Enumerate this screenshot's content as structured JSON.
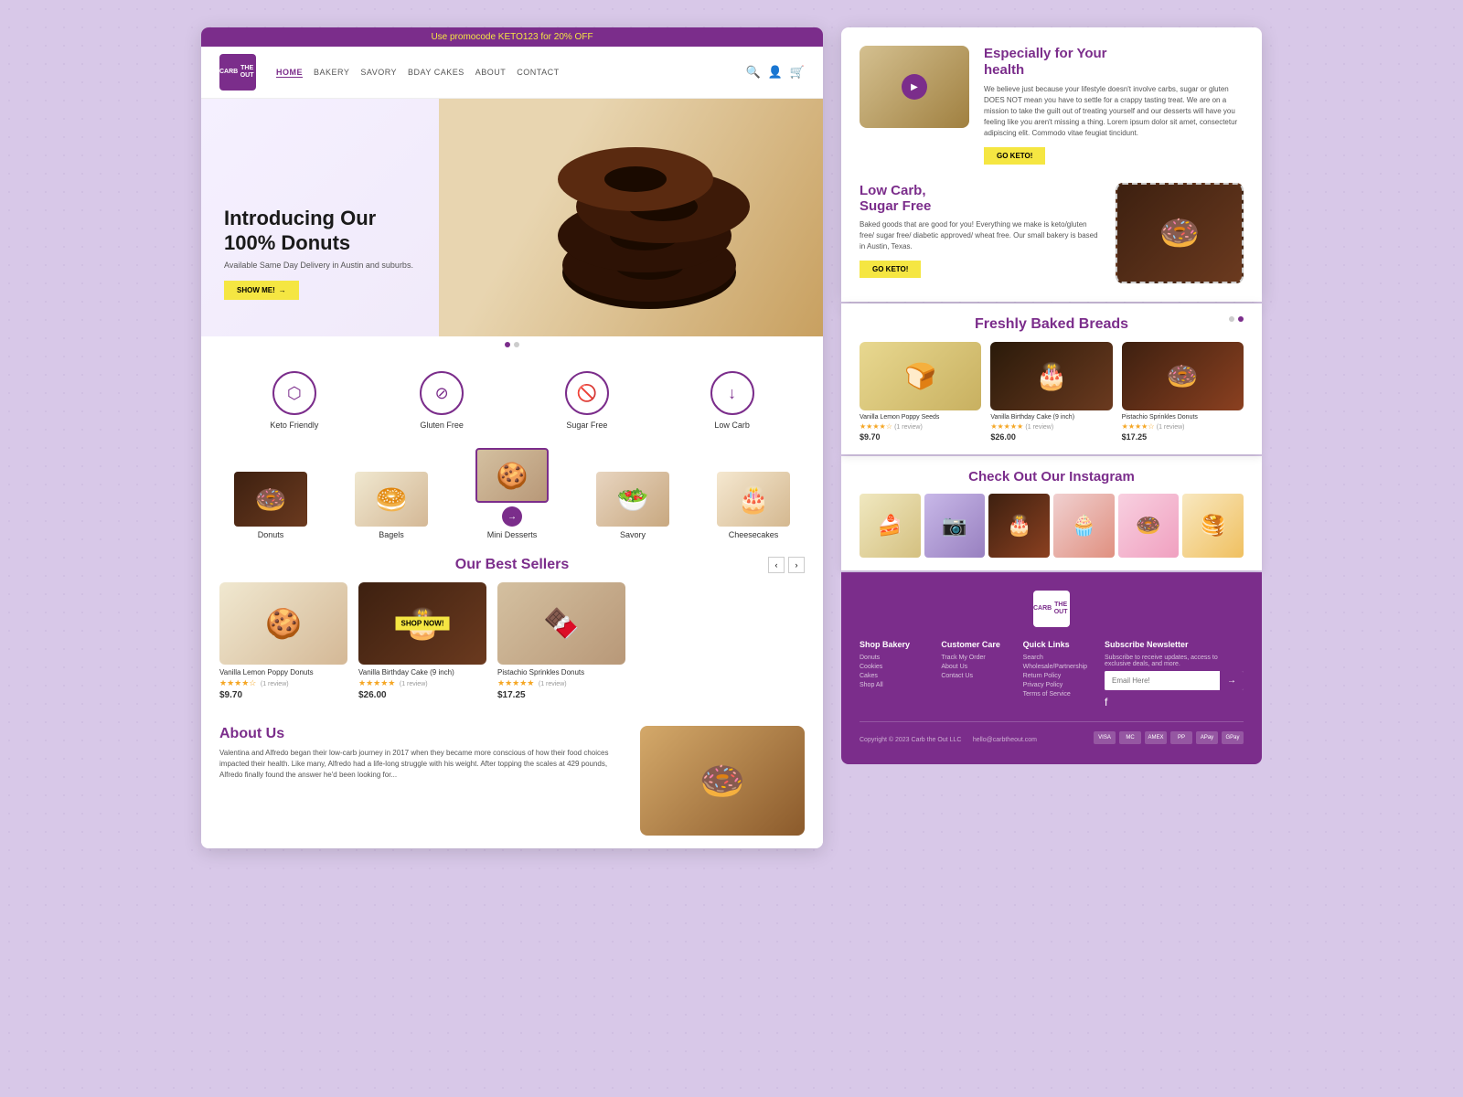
{
  "promo": {
    "text": "Use promocode KETO123 for 20% OFF",
    "highlight": "KETO123"
  },
  "nav": {
    "logo_line1": "CARB",
    "logo_line2": "THE OUT",
    "links": [
      "HOME",
      "BAKERY",
      "SAVORY",
      "BDAY CAKES",
      "ABOUT",
      "CONTACT"
    ],
    "active": "HOME"
  },
  "hero": {
    "title_line1": "Introducing Our",
    "title_line2": "100% Donuts",
    "subtitle": "Available Same Day Delivery in Austin and suburbs.",
    "btn_label": "SHOW ME!"
  },
  "features": [
    {
      "icon": "🎲",
      "label": "Keto Friendly"
    },
    {
      "icon": "🚫",
      "label": "Gluten Free"
    },
    {
      "icon": "🍭",
      "label": "Sugar Free"
    },
    {
      "icon": "⬇️",
      "label": "Low Carb"
    }
  ],
  "categories": [
    {
      "icon": "🍩",
      "label": "Donuts"
    },
    {
      "icon": "🥯",
      "label": "Bagels"
    },
    {
      "icon": "🍪",
      "label": "Mini Desserts",
      "active": true
    },
    {
      "icon": "🥗",
      "label": "Savory"
    },
    {
      "icon": "🎂",
      "label": "Cheesecakes"
    }
  ],
  "best_sellers": {
    "title": "Our Best Sellers",
    "products": [
      {
        "name": "Vanilla Lemon Poppy Donuts",
        "stars": "★★★★☆",
        "reviews": "(1 review)",
        "price": "$9.70"
      },
      {
        "name": "Vanilla Birthday Cake (9 inch)",
        "stars": "★★★★★",
        "reviews": "(1 review)",
        "price": "$26.00",
        "badge": "SHOP NOW!"
      },
      {
        "name": "Pistachio Sprinkles Donuts",
        "stars": "★★★★★",
        "reviews": "(1 review)",
        "price": "$17.25"
      }
    ]
  },
  "about": {
    "title": "About Us",
    "text": "Valentina and Alfredo began their low-carb journey in 2017 when they became more conscious of how their food choices impacted their health. Like many, Alfredo had a life-long struggle with his weight. After topping the scales at 429 pounds, Alfredo finally found the answer he'd been looking for..."
  },
  "right": {
    "keto": {
      "title_line1": "Especially for Your",
      "title_line2": "health",
      "body": "We believe just because your lifestyle doesn't involve carbs, sugar or gluten DOES NOT mean you have to settle for a crappy tasting treat. We are on a mission to take the guilt out of treating yourself and our desserts will have you feeling like you aren't missing a thing. Lorem ipsum dolor sit amet, consectetur adipiscing elit. Commodo vitae feugiat tincidunt.",
      "btn_label": "GO KETO!"
    },
    "low_carb": {
      "title_line1": "Low Carb,",
      "title_line2": "Sugar Free",
      "body": "Baked goods that are good for you! Everything we make is keto/gluten free/ sugar free/ diabetic approved/ wheat free. Our small bakery is based in Austin, Texas.",
      "btn_label": "GO KETO!"
    },
    "freshly": {
      "title": "Freshly Baked Breads",
      "products": [
        {
          "name": "Vanilla Lemon Poppy Seeds",
          "stars": "★★★★☆",
          "reviews": "(1 review)",
          "price": "$9.70"
        },
        {
          "name": "Vanilla Birthday Cake (9 inch)",
          "stars": "★★★★★",
          "reviews": "(1 review)",
          "price": "$26.00"
        },
        {
          "name": "Pistachio Sprinkles Donuts",
          "stars": "★★★★☆",
          "reviews": "(1 review)",
          "price": "$17.25"
        }
      ]
    },
    "instagram": {
      "title": "Check Out Our Instagram"
    },
    "footer": {
      "logo_line1": "CARB",
      "logo_line2": "THE OUT",
      "shop_bakery": {
        "title": "Shop Bakery",
        "items": [
          "Donuts",
          "Cookies",
          "Cakes",
          "Shop All"
        ]
      },
      "customer_care": {
        "title": "Customer Care",
        "items": [
          "Track My Order",
          "About Us",
          "Contact Us"
        ]
      },
      "quick_links": {
        "title": "Quick Links",
        "items": [
          "Search",
          "Wholesale/Partnership",
          "Return Policy",
          "Privacy Policy",
          "Terms of Service"
        ]
      },
      "newsletter": {
        "title": "Subscribe Newsletter",
        "subtitle": "Subscribe to receive updates, access to exclusive deals, and more.",
        "placeholder": "Email Here!",
        "btn": "→"
      },
      "copyright": "Copyright © 2023 Carb the Out LLC",
      "email": "hello@carbtheout.com",
      "payment_icons": [
        "VISA",
        "MC",
        "AMEX",
        "PP",
        "APay",
        "GPay"
      ]
    }
  }
}
